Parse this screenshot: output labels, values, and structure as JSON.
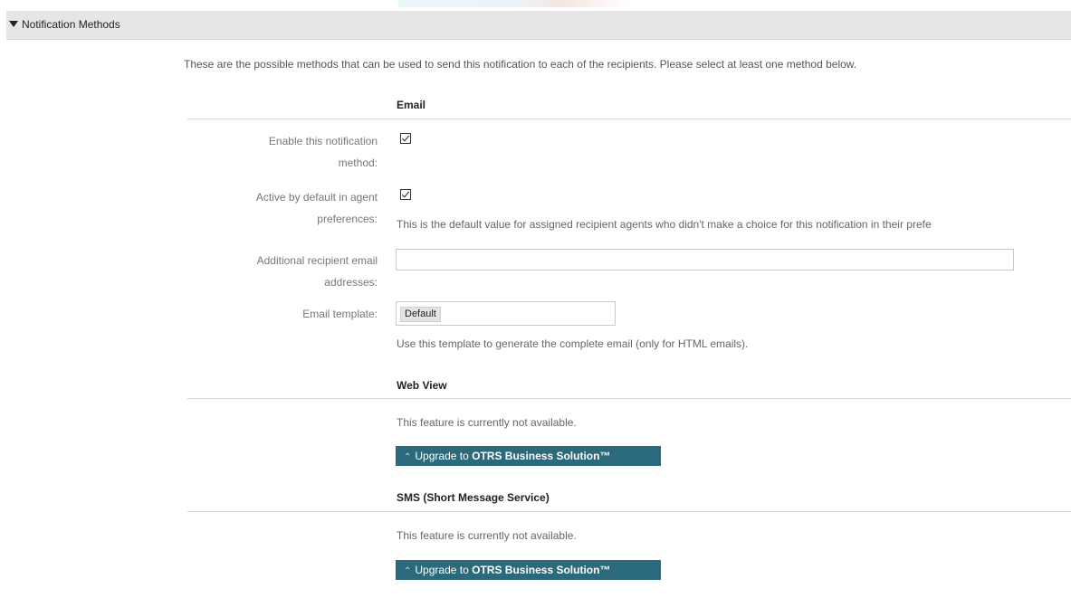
{
  "header": {
    "title": "Notification Methods"
  },
  "intro": "These are the possible methods that can be used to send this notification to each of the recipients. Please select at least one method below.",
  "email": {
    "title": "Email",
    "enable_label_1": "Enable this notification",
    "enable_label_2": "method:",
    "enable_checked": true,
    "active_label_1": "Active by default in agent",
    "active_label_2": "preferences:",
    "active_checked": true,
    "active_hint": "This is the default value for assigned recipient agents who didn't make a choice for this notification in their prefe",
    "additional_label_1": "Additional recipient email",
    "additional_label_2": "addresses:",
    "additional_value": "",
    "template_label": "Email template:",
    "template_value": "Default",
    "template_hint": "Use this template to generate the complete email (only for HTML emails)."
  },
  "webview": {
    "title": "Web View",
    "not_available": "This feature is currently not available.",
    "upgrade_prefix": "Upgrade to ",
    "upgrade_product": "OTRS Business Solution™"
  },
  "sms": {
    "title": "SMS (Short Message Service)",
    "not_available": "This feature is currently not available.",
    "upgrade_prefix": "Upgrade to ",
    "upgrade_product": "OTRS Business Solution™"
  },
  "icons": {
    "collapse": "triangle-down-icon",
    "upgrade": "double-chevron-up-icon",
    "checkbox": "checkbox-checked-icon"
  },
  "colors": {
    "header_bg": "#e6e6e6",
    "upgrade_bg": "#2b6a7c"
  }
}
